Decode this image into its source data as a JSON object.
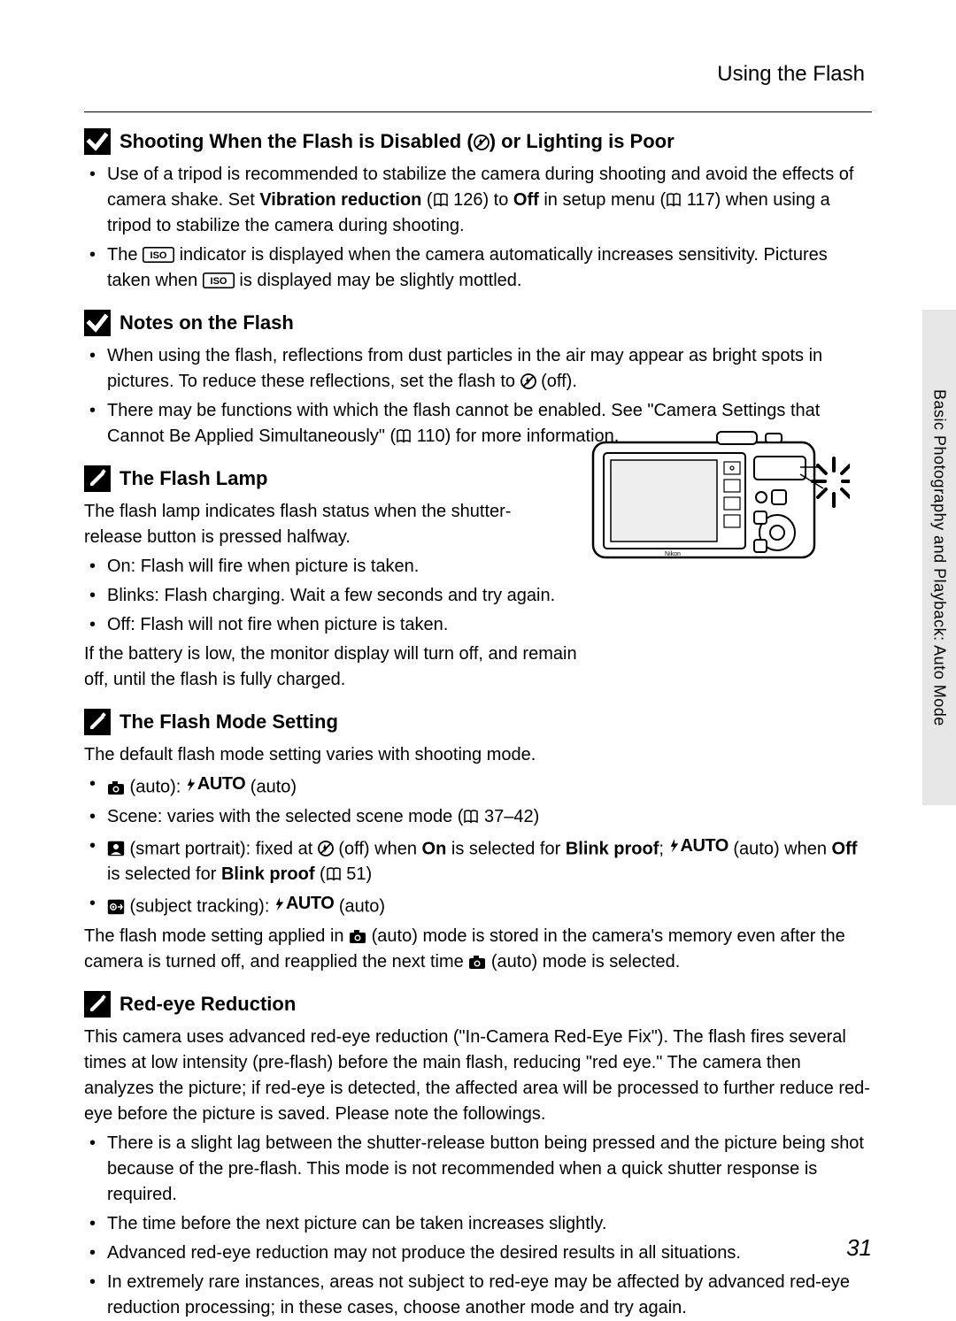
{
  "running_head": "Using the Flash",
  "side_tab": "Basic Photography and Playback: Auto Mode",
  "page_number": "31",
  "sections": {
    "s1": {
      "title_pre": "Shooting When the Flash is Disabled (",
      "title_post": ") or Lighting is Poor",
      "b1_a": "Use of a tripod is recommended to stabilize the camera during shooting and avoid the effects of camera shake. Set ",
      "b1_vr": "Vibration reduction",
      "b1_b": " (",
      "b1_ref1": " 126) to ",
      "b1_off": "Off",
      "b1_c": " in setup menu (",
      "b1_ref2": " 117) when using a tripod to stabilize the camera during shooting.",
      "b2_a": "The ",
      "b2_b": " indicator is displayed when the camera automatically increases sensitivity. Pictures taken when ",
      "b2_c": " is displayed may be slightly mottled."
    },
    "s2": {
      "title": "Notes on the Flash",
      "b1_a": "When using the flash, reflections from dust particles in the air may appear as bright spots in pictures. To reduce these reflections, set the flash to ",
      "b1_b": " (off).",
      "b2_a": "There may be functions with which the flash cannot be enabled. See \"Camera Settings that Cannot Be Applied Simultaneously\" (",
      "b2_b": " 110) for more information."
    },
    "s3": {
      "title": "The Flash Lamp",
      "intro": "The flash lamp indicates flash status when the shutter-release button is pressed halfway.",
      "b1": "On: Flash will fire when picture is taken.",
      "b2": "Blinks: Flash charging. Wait a few seconds and try again.",
      "b3": "Off: Flash will not fire when picture is taken.",
      "outro": "If the battery is low, the monitor display will turn off, and remain off, until the flash is fully charged."
    },
    "s4": {
      "title": "The Flash Mode Setting",
      "intro": "The default flash mode setting varies with shooting mode.",
      "b1_a": " (auto): ",
      "b1_b": " (auto)",
      "b2_a": "Scene: varies with the selected scene mode (",
      "b2_b": " 37–42)",
      "b3_a": " (smart portrait): fixed at ",
      "b3_b": " (off) when ",
      "b3_on": "On",
      "b3_c": " is selected for ",
      "b3_bp": "Blink proof",
      "b3_d": "; ",
      "b3_e": " (auto) when ",
      "b3_off": "Off",
      "b3_f": " is selected for ",
      "b3_bp2": "Blink proof",
      "b3_g": " (",
      "b3_h": " 51)",
      "b4_a": " (subject tracking): ",
      "b4_b": " (auto)",
      "outro_a": "The flash mode setting applied in ",
      "outro_b": " (auto) mode is stored in the camera's memory even after the camera is turned off, and reapplied the next time ",
      "outro_c": " (auto) mode is selected."
    },
    "s5": {
      "title": "Red-eye Reduction",
      "intro": "This camera uses advanced red-eye reduction (\"In-Camera Red-Eye Fix\"). The flash fires several times at low intensity (pre-flash) before the main flash, reducing \"red eye.\" The camera then analyzes the picture; if red-eye is detected, the affected area will be processed to further reduce red-eye before the picture is saved. Please note the followings.",
      "b1": "There is a slight lag between the shutter-release button being pressed and the picture being shot because of the pre-flash. This mode is not recommended when a quick shutter response is required.",
      "b2": "The time before the next picture can be taken increases slightly.",
      "b3": "Advanced red-eye reduction may not produce the desired results in all situations.",
      "b4": "In extremely rare instances, areas not subject to red-eye may be affected by advanced red-eye reduction processing; in these cases, choose another mode and try again."
    }
  },
  "glyphs": {
    "auto_label": "AUTO"
  }
}
